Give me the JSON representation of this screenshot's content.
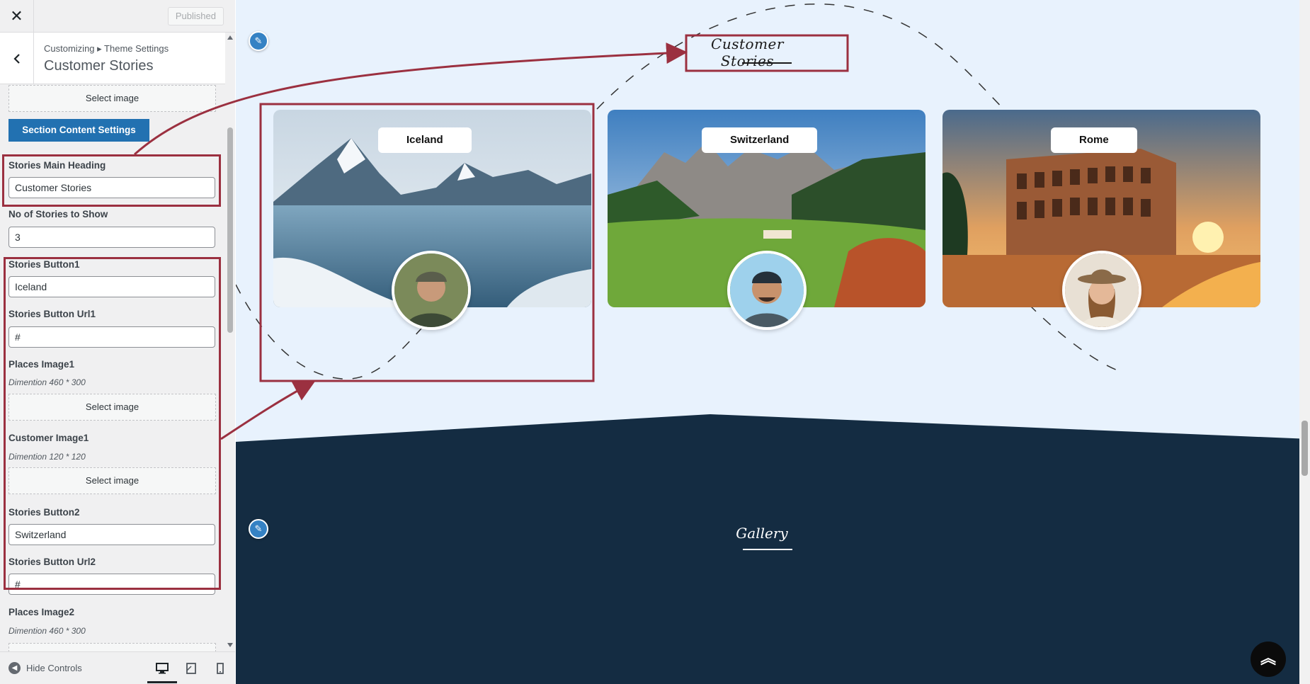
{
  "topbar": {
    "close_label": "✕",
    "published_label": "Published"
  },
  "section": {
    "breadcrumb": "Customizing ▸ Theme Settings",
    "title": "Customer Stories"
  },
  "panel": {
    "select_image_top": "Select image",
    "section_content_button": "Section Content Settings",
    "main_heading_label": "Stories Main Heading",
    "main_heading_value": "Customer Stories",
    "no_stories_label": "No of Stories to Show",
    "no_stories_value": "3",
    "button1_label": "Stories Button1",
    "button1_value": "Iceland",
    "url1_label": "Stories Button Url1",
    "url1_value": "#",
    "places_image1_label": "Places Image1",
    "places_image1_note": "Dimention 460 * 300",
    "places_image1_select": "Select image",
    "customer_image1_label": "Customer Image1",
    "customer_image1_note": "Dimention 120 * 120",
    "customer_image1_select": "Select image",
    "button2_label": "Stories Button2",
    "button2_value": "Switzerland",
    "url2_label": "Stories Button Url2",
    "url2_value": "#",
    "places_image2_label": "Places Image2",
    "places_image2_note": "Dimention 460 * 300"
  },
  "footer": {
    "hide_controls": "Hide Controls"
  },
  "preview": {
    "heading": "Customer Stories",
    "gallery_heading": "Gallery",
    "stories": [
      {
        "button": "Iceland",
        "scene": "iceland-landscape",
        "avatar": "man-cap-avatar"
      },
      {
        "button": "Switzerland",
        "scene": "alps-valley-landscape",
        "avatar": "man-beanie-avatar"
      },
      {
        "button": "Rome",
        "scene": "colosseum-sunset",
        "avatar": "woman-hat-avatar"
      }
    ]
  },
  "colors": {
    "accent": "#2271b1",
    "highlight": "#9b3040",
    "dark_section": "#142c42",
    "preview_bg": "#e8f2fd"
  }
}
